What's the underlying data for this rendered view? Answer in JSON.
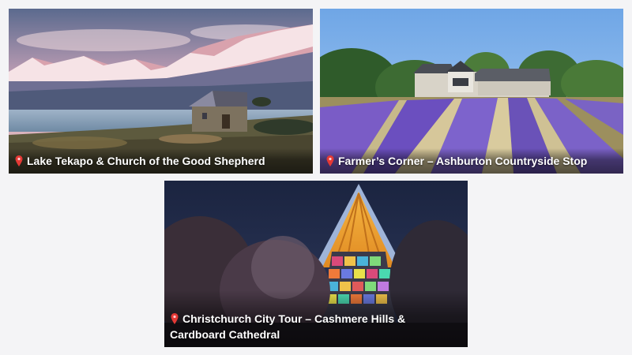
{
  "cards": [
    {
      "title": "Lake Tekapo & Church of the Good Shepherd",
      "icon": "location-pin-icon"
    },
    {
      "title": "Farmer’s Corner – Ashburton Countryside Stop",
      "icon": "location-pin-icon"
    },
    {
      "title": "Christchurch City Tour – Cashmere Hills & Cardboard Cathedral",
      "icon": "location-pin-icon"
    }
  ],
  "colors": {
    "background": "#f4f4f6",
    "pin": "#e53935",
    "caption_text": "#ffffff"
  }
}
